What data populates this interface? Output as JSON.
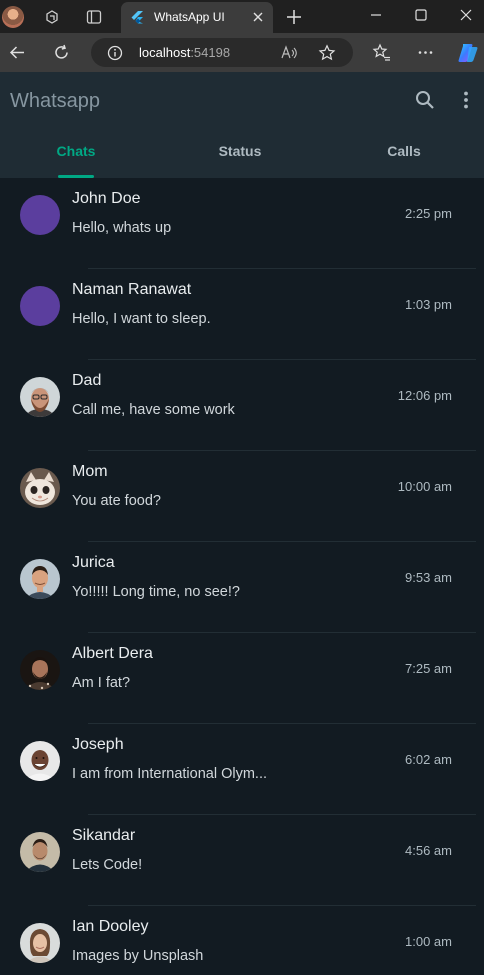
{
  "browser": {
    "tab_title": "WhatsApp UI",
    "url_host": "localhost",
    "url_port": ":54198"
  },
  "app": {
    "title": "Whatsapp",
    "tabs": [
      {
        "label": "Chats",
        "active": true
      },
      {
        "label": "Status",
        "active": false
      },
      {
        "label": "Calls",
        "active": false
      }
    ],
    "accent_color": "#00a884"
  },
  "chats": [
    {
      "name": "John Doe",
      "message": "Hello, whats up",
      "time": "2:25 pm",
      "avatar": "placeholder"
    },
    {
      "name": "Naman Ranawat",
      "message": "Hello, I want to sleep.",
      "time": "1:03 pm",
      "avatar": "placeholder"
    },
    {
      "name": "Dad",
      "message": "Call me, have some work",
      "time": "12:06 pm",
      "avatar": "photo"
    },
    {
      "name": "Mom",
      "message": "You ate food?",
      "time": "10:00 am",
      "avatar": "photo"
    },
    {
      "name": "Jurica",
      "message": "Yo!!!!! Long time, no see!?",
      "time": "9:53 am",
      "avatar": "photo"
    },
    {
      "name": "Albert Dera",
      "message": "Am I fat?",
      "time": "7:25 am",
      "avatar": "photo"
    },
    {
      "name": "Joseph",
      "message": "I am from International Olym...",
      "time": "6:02 am",
      "avatar": "photo"
    },
    {
      "name": "Sikandar",
      "message": "Lets Code!",
      "time": "4:56 am",
      "avatar": "photo"
    },
    {
      "name": "Ian Dooley",
      "message": "Images by Unsplash",
      "time": "1:00 am",
      "avatar": "photo"
    }
  ]
}
